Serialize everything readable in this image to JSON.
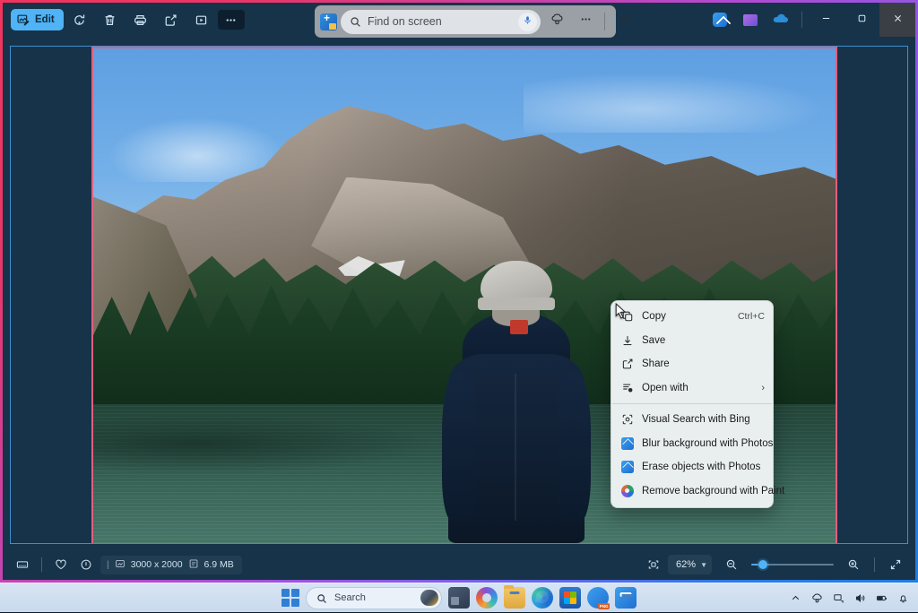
{
  "window": {
    "accent_gradient": [
      "#f0355c",
      "#b44ad0",
      "#1f7fe0"
    ],
    "background": "#163349"
  },
  "toolbar": {
    "edit_label": "Edit",
    "buttons": [
      {
        "name": "edit-button",
        "label": "Edit",
        "icon": "edit-image-icon"
      },
      {
        "name": "rotate-button",
        "label": "Rotate",
        "icon": "rotate-icon"
      },
      {
        "name": "delete-button",
        "label": "Delete",
        "icon": "trash-icon"
      },
      {
        "name": "print-button",
        "label": "Print",
        "icon": "printer-icon"
      },
      {
        "name": "share-button",
        "label": "Share",
        "icon": "share-icon"
      },
      {
        "name": "slideshow-button",
        "label": "Slideshow",
        "icon": "play-box-icon"
      },
      {
        "name": "more-options-button",
        "label": "See more",
        "icon": "ellipsis-icon"
      }
    ]
  },
  "find_bar": {
    "placeholder": "Find on screen",
    "value": "",
    "logo_icon": "bing-visual-search-icon",
    "search_icon": "search-icon",
    "mic_icon": "microphone-icon",
    "settings_icon": "copilot-settings-icon",
    "more_icon": "ellipsis-icon",
    "close_icon": "close-icon"
  },
  "titlebar_right": {
    "apps": [
      {
        "name": "photos-app-icon",
        "label": "Photos"
      },
      {
        "name": "designer-app-icon",
        "label": "Designer"
      },
      {
        "name": "onedrive-icon",
        "label": "OneDrive"
      }
    ],
    "minimize_label": "Minimize",
    "maximize_label": "Restore",
    "close_label": "Close"
  },
  "context_menu": {
    "items": [
      {
        "label": "Copy",
        "accel": "Ctrl+C",
        "icon": "copy-icon",
        "type": "item"
      },
      {
        "label": "Save",
        "accel": "",
        "icon": "download-icon",
        "type": "item"
      },
      {
        "label": "Share",
        "accel": "",
        "icon": "share-icon",
        "type": "item"
      },
      {
        "label": "Open with",
        "accel": "",
        "icon": "open-with-icon",
        "type": "submenu",
        "chevron": "›"
      },
      {
        "type": "separator"
      },
      {
        "label": "Visual Search with Bing",
        "accel": "",
        "icon": "visual-search-icon",
        "type": "item"
      },
      {
        "label": "Blur background with Photos",
        "accel": "",
        "icon": "photos-app-icon",
        "type": "item"
      },
      {
        "label": "Erase objects with Photos",
        "accel": "",
        "icon": "photos-app-icon",
        "type": "item"
      },
      {
        "label": "Remove background with Paint",
        "accel": "",
        "icon": "paint-app-icon",
        "type": "item"
      }
    ]
  },
  "status_bar": {
    "filmstrip_icon": "filmstrip-icon",
    "favorite_icon": "heart-icon",
    "info_icon": "info-icon",
    "dimensions": "3000 x 2000",
    "file_size": "6.9 MB",
    "dimensions_icon": "image-size-icon",
    "filesize_icon": "file-icon",
    "fit_icon": "fit-to-window-icon",
    "zoom_level": "62%",
    "zoom_chevron": "⌄",
    "zoom_out_icon": "zoom-out-icon",
    "zoom_in_icon": "zoom-in-icon",
    "fullscreen_icon": "fullscreen-icon"
  },
  "taskbar": {
    "start_label": "Start",
    "search_placeholder": "Search",
    "apps": [
      {
        "name": "taskbar-teams-icon",
        "label": "Microsoft Teams",
        "active": false
      },
      {
        "name": "taskbar-copilot-icon",
        "label": "Copilot",
        "active": false
      },
      {
        "name": "taskbar-file-explorer-icon",
        "label": "File Explorer",
        "active": true
      },
      {
        "name": "taskbar-edge-icon",
        "label": "Microsoft Edge",
        "active": false
      },
      {
        "name": "taskbar-store-icon",
        "label": "Microsoft Store",
        "active": false
      },
      {
        "name": "taskbar-onedrive-png-icon",
        "label": "OneDrive",
        "active": false
      },
      {
        "name": "taskbar-photos-icon",
        "label": "Photos",
        "active": true
      }
    ],
    "tray": [
      {
        "name": "tray-expand-icon",
        "label": "Show hidden icons"
      },
      {
        "name": "tray-onedrive-icon",
        "label": "OneDrive"
      },
      {
        "name": "tray-network-icon",
        "label": "Network"
      },
      {
        "name": "tray-volume-icon",
        "label": "Volume"
      },
      {
        "name": "tray-battery-icon",
        "label": "Battery"
      },
      {
        "name": "tray-notification-icon",
        "label": "Notifications"
      }
    ]
  }
}
